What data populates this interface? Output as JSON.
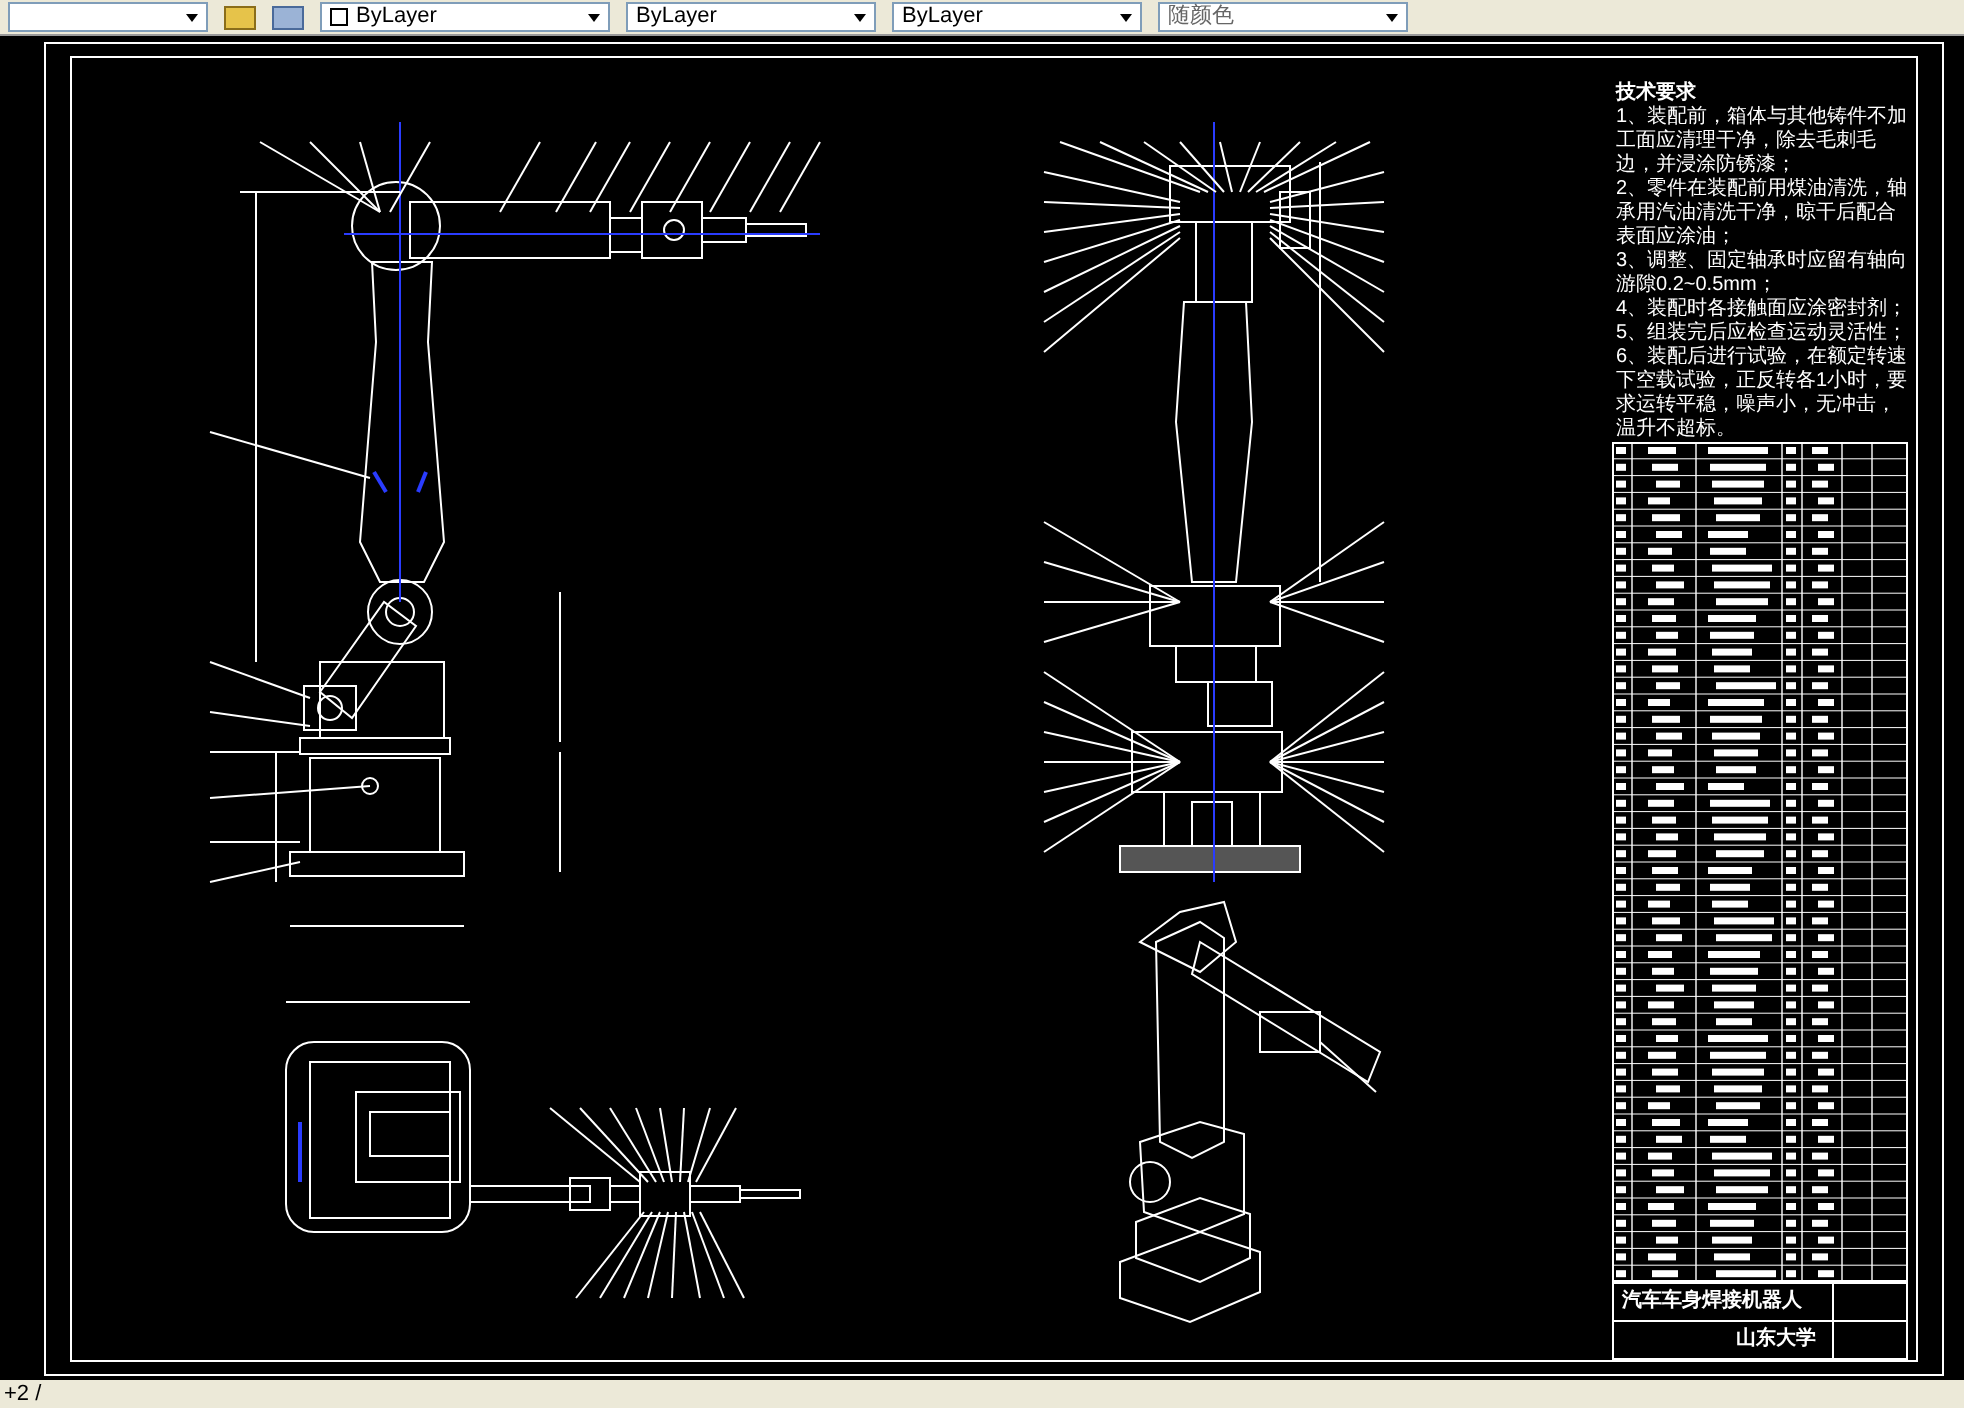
{
  "toolbar": {
    "combos": [
      {
        "value": "ByLayer"
      },
      {
        "value": "ByLayer"
      },
      {
        "value": "ByLayer"
      },
      {
        "value": "随颜色"
      }
    ]
  },
  "notes": {
    "title": "技术要求",
    "items": [
      "1、装配前，箱体与其他铸件不加工面应清理干净，除去毛刺毛边，并浸涂防锈漆；",
      "2、零件在装配前用煤油清洗，轴承用汽油清洗干净，晾干后配合表面应涂油；",
      "3、调整、固定轴承时应留有轴向游隙0.2~0.5mm；",
      "4、装配时各接触面应涂密封剂；",
      "5、组装完后应检查运动灵活性；",
      "6、装配后进行试验，在额定转速下空载试验，正反转各1小时，要求运转平稳，噪声小，无冲击，温升不超标。"
    ]
  },
  "title_block": {
    "title": "汽车车身焊接机器人",
    "school": "山东大学"
  },
  "command_line": {
    "text": "+2 /"
  }
}
